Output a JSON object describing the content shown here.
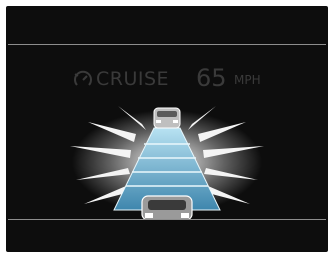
{
  "cluster": {
    "cruise_icon": "cruise-speedometer-icon",
    "cruise_label": "CRUISE",
    "set_speed": "65",
    "speed_unit": "MPH"
  },
  "scene": {
    "lead_vehicle_icon": "car-rear-icon",
    "own_vehicle_icon": "car-rear-icon",
    "following_distance_bars": 4,
    "colors": {
      "background": "#0d0d0d",
      "divider": "#8d8d8d",
      "cruise_text": "#3a3a3a",
      "lane_light": "#9cd2e8",
      "lane_dark": "#4a93b8",
      "glow": "#ffffff"
    }
  }
}
